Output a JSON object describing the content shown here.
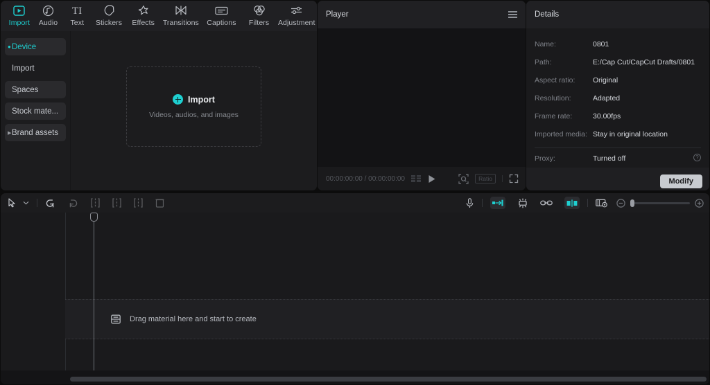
{
  "tabs": [
    {
      "label": "Import",
      "icon": "import-icon",
      "active": true
    },
    {
      "label": "Audio",
      "icon": "audio-note-icon",
      "active": false
    },
    {
      "label": "Text",
      "icon": "text-ti-icon",
      "active": false
    },
    {
      "label": "Stickers",
      "icon": "sticker-icon",
      "active": false
    },
    {
      "label": "Effects",
      "icon": "effects-sparkle-icon",
      "active": false
    },
    {
      "label": "Transitions",
      "icon": "transitions-bowtie-icon",
      "active": false
    },
    {
      "label": "Captions",
      "icon": "captions-icon",
      "active": false
    },
    {
      "label": "Filters",
      "icon": "filters-circles-icon",
      "active": false
    },
    {
      "label": "Adjustment",
      "icon": "adjustment-sliders-icon",
      "active": false
    }
  ],
  "sidebar": {
    "items": [
      {
        "label": "Device",
        "active": true,
        "marker": "bullet"
      },
      {
        "label": "Import",
        "active": false,
        "marker": "none"
      },
      {
        "label": "Spaces",
        "active": false,
        "marker": "none"
      },
      {
        "label": "Stock mate...",
        "active": false,
        "marker": "none"
      },
      {
        "label": "Brand assets",
        "active": false,
        "marker": "caret"
      }
    ]
  },
  "import_zone": {
    "label": "Import",
    "subtitle": "Videos, audios, and images"
  },
  "player": {
    "title": "Player",
    "current_time": "00:00:00:00",
    "total_time": "00:00:00:00",
    "timecode": "00:00:00:00 / 00:00:00:00",
    "ratio_badge": "Ratio"
  },
  "details": {
    "title": "Details",
    "rows": [
      {
        "label": "Name:",
        "value": "0801"
      },
      {
        "label": "Path:",
        "value": "E:/Cap Cut/CapCut Drafts/0801"
      },
      {
        "label": "Aspect ratio:",
        "value": "Original"
      },
      {
        "label": "Resolution:",
        "value": "Adapted"
      },
      {
        "label": "Frame rate:",
        "value": "30.00fps"
      },
      {
        "label": "Imported media:",
        "value": "Stay in original location"
      }
    ],
    "proxy": {
      "label": "Proxy:",
      "value": "Turned off",
      "help": "?"
    },
    "modify_label": "Modify"
  },
  "timeline": {
    "dropzone_text": "Drag material here and start to create"
  },
  "colors": {
    "accent": "#1ecfd0",
    "panel": "#1c1c1e",
    "stage": "#131315",
    "text": "#d3d6db",
    "muted": "#7e8188"
  }
}
